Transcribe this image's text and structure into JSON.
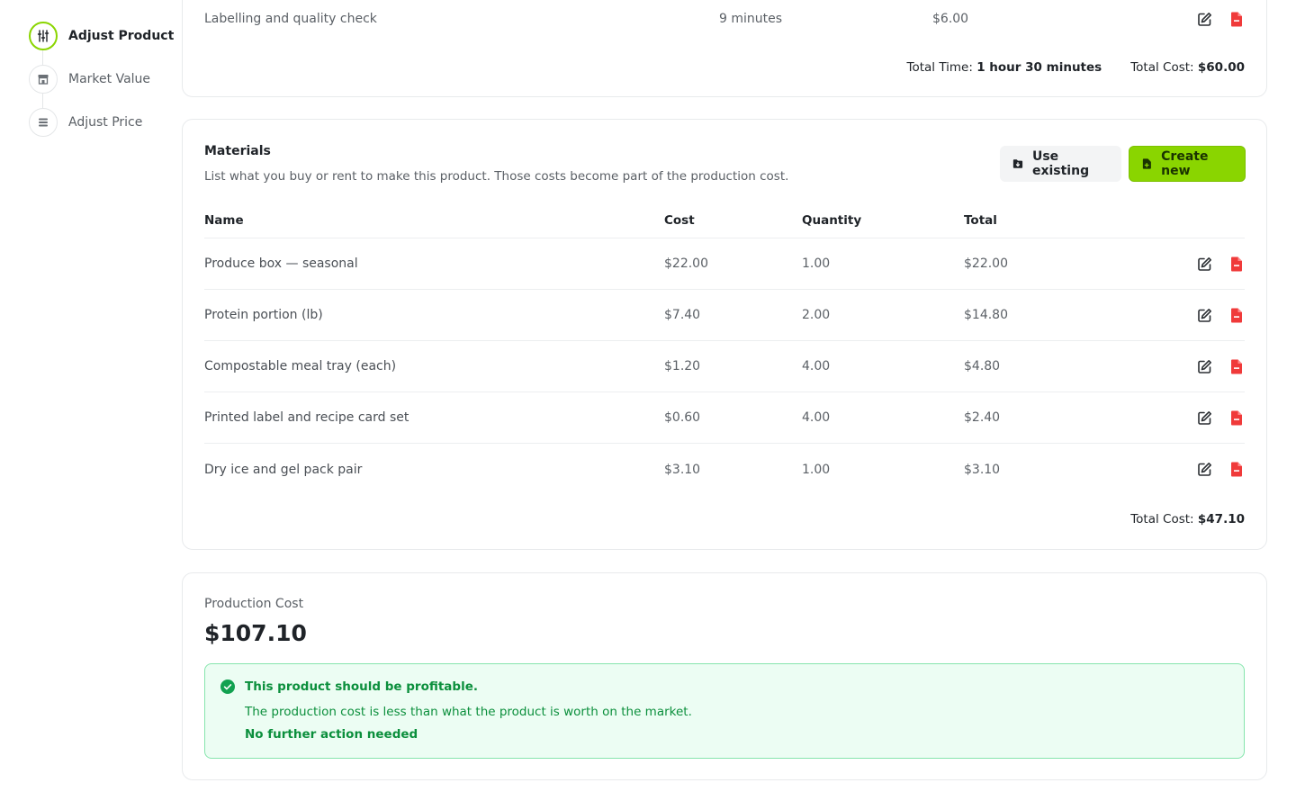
{
  "colors": {
    "accent": "#8ad500",
    "danger": "#f03a3a",
    "success": "#0b8f3c",
    "success_bg": "#ecfdf3"
  },
  "stepper": {
    "steps": [
      {
        "label": "Adjust Product",
        "icon": "sliders-icon",
        "active": true
      },
      {
        "label": "Market Value",
        "icon": "store-icon",
        "active": false
      },
      {
        "label": "Adjust Price",
        "icon": "price-list-icon",
        "active": false
      }
    ]
  },
  "labour": {
    "last_row": {
      "name": "Labelling and quality check",
      "time": "9 minutes",
      "cost": "$6.00"
    },
    "total_time_label": "Total Time:",
    "total_time_value": "1 hour 30 minutes",
    "total_cost_label": "Total Cost:",
    "total_cost_value": "$60.00"
  },
  "materials": {
    "title": "Materials",
    "description": "List what you buy or rent to make this product. Those costs become part of the production cost.",
    "use_existing_label": "Use existing",
    "create_new_label": "Create new",
    "columns": {
      "name": "Name",
      "cost": "Cost",
      "quantity": "Quantity",
      "total": "Total"
    },
    "rows": [
      {
        "name": "Produce box — seasonal",
        "cost": "$22.00",
        "quantity": "1.00",
        "total": "$22.00"
      },
      {
        "name": "Protein portion (lb)",
        "cost": "$7.40",
        "quantity": "2.00",
        "total": "$14.80"
      },
      {
        "name": "Compostable meal tray (each)",
        "cost": "$1.20",
        "quantity": "4.00",
        "total": "$4.80"
      },
      {
        "name": "Printed label and recipe card set",
        "cost": "$0.60",
        "quantity": "4.00",
        "total": "$2.40"
      },
      {
        "name": "Dry ice and gel pack pair",
        "cost": "$3.10",
        "quantity": "1.00",
        "total": "$3.10"
      }
    ],
    "total_cost_label": "Total Cost:",
    "total_cost_value": "$47.10"
  },
  "production": {
    "label": "Production Cost",
    "value": "$107.10",
    "alert": {
      "title": "This product should be profitable.",
      "text": "The production cost is less than what the product is worth on the market.",
      "action": "No further action needed"
    }
  }
}
